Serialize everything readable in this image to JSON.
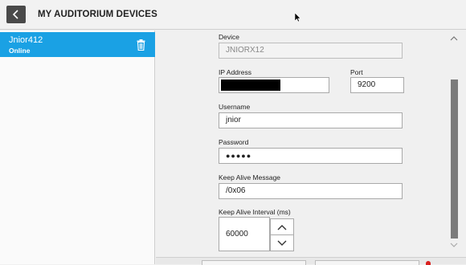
{
  "header": {
    "title": "MY AUDITORIUM DEVICES"
  },
  "sidebar": {
    "devices": [
      {
        "name": "Jnior412",
        "status": "Online"
      }
    ]
  },
  "form": {
    "device_label": "Device",
    "device_value": "JNIORX12",
    "ip_label": "IP Address",
    "port_label": "Port",
    "port_value": "9200",
    "username_label": "Username",
    "username_value": "jnior",
    "password_label": "Password",
    "password_value": "●●●●●",
    "keepalive_msg_label": "Keep Alive Message",
    "keepalive_msg_value": "/0x06",
    "keepalive_interval_label": "Keep Alive Interval (ms)",
    "keepalive_interval_value": "60000"
  },
  "colors": {
    "accent": "#1aa1e4",
    "header_button": "#4a4a4a"
  },
  "icons": {
    "back": "chevron-left-icon",
    "delete": "trash-icon",
    "up": "chevron-up-icon",
    "down": "chevron-down-icon"
  }
}
